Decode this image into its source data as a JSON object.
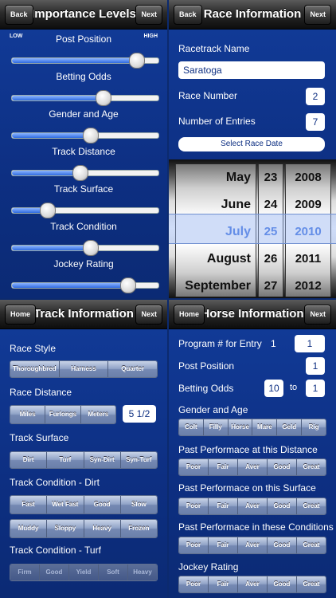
{
  "importance": {
    "back": "Back",
    "title": "Importance Levels",
    "next": "Next",
    "low": "LOW",
    "high": "HIGH",
    "sliders": [
      {
        "label": "Post Position",
        "value": 0.85
      },
      {
        "label": "Betting Odds",
        "value": 0.62
      },
      {
        "label": "Gender and Age",
        "value": 0.53
      },
      {
        "label": "Track Distance",
        "value": 0.46
      },
      {
        "label": "Track Surface",
        "value": 0.24
      },
      {
        "label": "Track Condition",
        "value": 0.53
      },
      {
        "label": "Jockey Rating",
        "value": 0.79
      }
    ]
  },
  "race": {
    "back": "Back",
    "title": "Race Information",
    "next": "Next",
    "track_label": "Racetrack Name",
    "track_value": "Saratoga",
    "number_label": "Race Number",
    "number_value": "2",
    "entries_label": "Number of Entries",
    "entries_value": "7",
    "date_button": "Select Race Date",
    "months": [
      "May",
      "June",
      "July",
      "August",
      "September"
    ],
    "days": [
      "23",
      "24",
      "25",
      "26",
      "27"
    ],
    "years": [
      "2008",
      "2009",
      "2010",
      "2011",
      "2012"
    ]
  },
  "track": {
    "home": "Home",
    "title": "Track Information",
    "next": "Next",
    "style_label": "Race Style",
    "style_options": [
      "Thoroughbred",
      "Harness",
      "Quarter"
    ],
    "distance_label": "Race Distance",
    "distance_options": [
      "Miles",
      "Furlongs",
      "Meters"
    ],
    "distance_value": "5 1/2",
    "surface_label": "Track Surface",
    "surface_options": [
      "Dirt",
      "Turf",
      "Syn-Dirt",
      "Syn-Turf"
    ],
    "dirt_label": "Track Condition - Dirt",
    "dirt_options_1": [
      "Fast",
      "Wet Fast",
      "Good",
      "Slow"
    ],
    "dirt_options_2": [
      "Muddy",
      "Sloppy",
      "Heavy",
      "Frozen"
    ],
    "turf_label": "Track Condition - Turf",
    "turf_options": [
      "Firm",
      "Good",
      "Yield",
      "Soft",
      "Heavy"
    ]
  },
  "horse": {
    "home": "Home",
    "title": "Horse Information",
    "next": "Next",
    "program_label": "Program # for Entry",
    "program_num": "1",
    "program_value": "1",
    "post_label": "Post Position",
    "post_value": "1",
    "odds_label": "Betting Odds",
    "odds_a": "10",
    "odds_to": "to",
    "odds_b": "1",
    "gender_label": "Gender and Age",
    "gender_options": [
      "Colt",
      "Filly",
      "Horse",
      "Mare",
      "Geld",
      "Rig"
    ],
    "perf_options": [
      "Poor",
      "Fair",
      "Aver",
      "Good",
      "Great"
    ],
    "distance_label": "Past Performace at this Distance",
    "surface_label": "Past Performace on this Surface",
    "conditions_label": "Past Performace in these Conditions",
    "jockey_label": "Jockey Rating"
  }
}
